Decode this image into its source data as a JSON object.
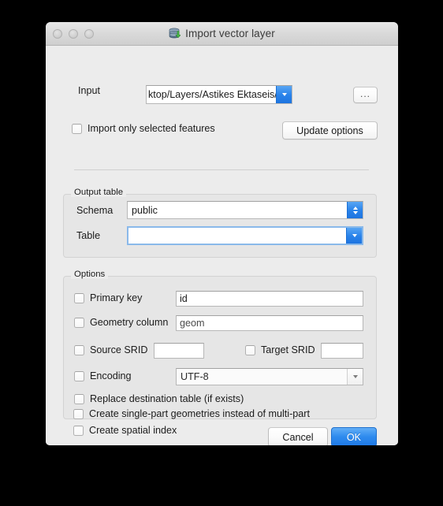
{
  "window": {
    "title": "Import vector layer",
    "title_icon": "database-import-icon",
    "traffic_lights": [
      "close-button",
      "minimize-button",
      "maximize-button"
    ]
  },
  "input_row": {
    "label": "Input",
    "value": "ktop/Layers/Astikes Ektaseis/astikes_ektaseis.shp",
    "browse_label": "...",
    "dropdown_icon": "chevron-down-icon"
  },
  "selected_features": {
    "checkbox_label": "Import only selected features",
    "checked": false,
    "update_button": "Update options"
  },
  "output_table": {
    "group_label": "Output table",
    "schema_label": "Schema",
    "schema_value": "public",
    "schema_icon": "chevron-up-down-icon",
    "table_label": "Table",
    "table_value": "",
    "table_icon": "chevron-down-icon"
  },
  "options": {
    "group_label": "Options",
    "primary_key": {
      "label": "Primary key",
      "value": "id",
      "checked": false
    },
    "geometry_column": {
      "label": "Geometry column",
      "value": "geom",
      "checked": false
    },
    "source_srid": {
      "label": "Source SRID",
      "value": "",
      "checked": false
    },
    "target_srid": {
      "label": "Target SRID",
      "value": "",
      "checked": false
    },
    "encoding": {
      "label": "Encoding",
      "value": "UTF-8",
      "checked": false,
      "icon": "chevron-down-icon"
    },
    "replace_table": {
      "label": "Replace destination table (if exists)",
      "checked": false
    },
    "single_part": {
      "label": "Create single-part geometries instead of multi-part",
      "checked": false
    },
    "spatial_index": {
      "label": "Create spatial index",
      "checked": false
    }
  },
  "footer": {
    "cancel_label": "Cancel",
    "ok_label": "OK"
  },
  "colors": {
    "accent": "#2a83ea",
    "window_bg": "#ececec",
    "group_bg": "#e6e6e6",
    "desktop_bg": "#000000"
  }
}
